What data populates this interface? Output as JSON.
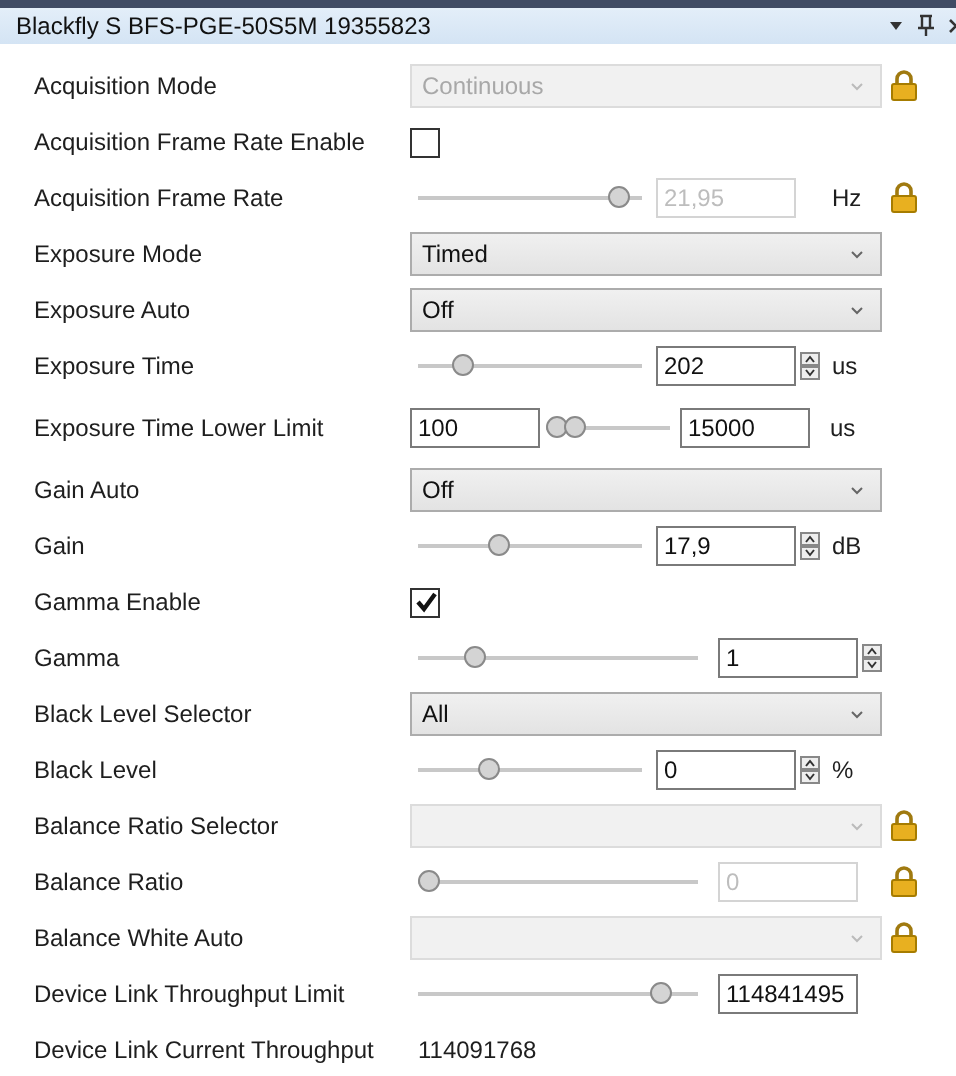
{
  "panel": {
    "title": "Blackfly S BFS-PGE-50S5M 19355823"
  },
  "properties": [
    {
      "label": "Acquisition Mode",
      "kind": "dropdown",
      "value": "Continuous",
      "locked": true
    },
    {
      "label": "Acquisition Frame Rate Enable",
      "kind": "checkbox",
      "checked": false,
      "locked": false
    },
    {
      "label": "Acquisition Frame Rate",
      "kind": "slider",
      "level": 0.95,
      "value": "21,95",
      "unit": "Hz",
      "spinner": false,
      "locked": true
    },
    {
      "label": "Exposure Mode",
      "kind": "dropdown",
      "value": "Timed",
      "locked": false
    },
    {
      "label": "Exposure Auto",
      "kind": "dropdown",
      "value": "Off",
      "locked": false
    },
    {
      "label": "Exposure Time",
      "kind": "slider",
      "level": 0.17,
      "value": "202",
      "unit": "us",
      "spinner": true,
      "locked": false
    },
    {
      "label": "Exposure Time Lower Limit",
      "kind": "range",
      "min_value": "100",
      "max_value": "15000",
      "unit": "us",
      "locked": false
    },
    {
      "label": "Gain Auto",
      "kind": "dropdown",
      "value": "Off",
      "locked": false
    },
    {
      "label": "Gain",
      "kind": "slider",
      "level": 0.35,
      "value": "17,9",
      "unit": "dB",
      "spinner": true,
      "locked": false
    },
    {
      "label": "Gamma Enable",
      "kind": "checkbox",
      "checked": true,
      "locked": false
    },
    {
      "label": "Gamma",
      "kind": "slider",
      "level": 0.18,
      "value": "1",
      "spinner": true,
      "locked": false
    },
    {
      "label": "Black Level Selector",
      "kind": "dropdown",
      "value": "All",
      "locked": false
    },
    {
      "label": "Black Level",
      "kind": "slider",
      "level": 0.3,
      "value": "0",
      "unit": "%",
      "spinner": true,
      "locked": false
    },
    {
      "label": "Balance Ratio Selector",
      "kind": "dropdown",
      "locked": true
    },
    {
      "label": "Balance Ratio",
      "kind": "slider",
      "level": 0,
      "value": "0",
      "spinner": false,
      "locked": true
    },
    {
      "label": "Balance White Auto",
      "kind": "dropdown",
      "locked": true
    },
    {
      "label": "Device Link Throughput Limit",
      "kind": "slider",
      "level": 0.91,
      "value": "114841495",
      "spinner": false,
      "locked": false
    },
    {
      "label": "Device Link Current Throughput",
      "kind": "text",
      "value": "114091768"
    }
  ]
}
